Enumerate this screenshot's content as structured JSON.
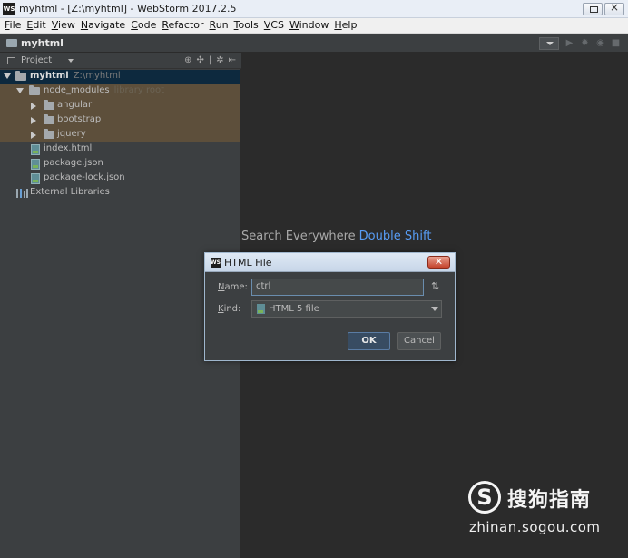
{
  "window": {
    "logo": "WS",
    "title": "myhtml - [Z:\\myhtml] - WebStorm 2017.2.5"
  },
  "menu": [
    {
      "first": "F",
      "rest": "ile"
    },
    {
      "first": "E",
      "rest": "dit"
    },
    {
      "first": "V",
      "rest": "iew"
    },
    {
      "first": "N",
      "rest": "avigate"
    },
    {
      "first": "C",
      "rest": "ode"
    },
    {
      "first": "R",
      "rest": "efactor"
    },
    {
      "first": "R",
      "rest": "un"
    },
    {
      "first": "T",
      "rest": "ools"
    },
    {
      "first": "V",
      "rest": "CS"
    },
    {
      "first": "W",
      "rest": "indow"
    },
    {
      "first": "H",
      "rest": "elp"
    }
  ],
  "navbar": {
    "project_name": "myhtml"
  },
  "project_panel": {
    "header_label": "Project",
    "tree": {
      "root": {
        "label": "myhtml",
        "path": "Z:\\myhtml"
      },
      "node_modules": {
        "label": "node_modules",
        "note": "library root"
      },
      "angular": "angular",
      "bootstrap": "bootstrap",
      "jquery": "jquery",
      "index_html": "index.html",
      "package_json": "package.json",
      "package_lock_json": "package-lock.json",
      "external_libraries": "External Libraries"
    }
  },
  "editor": {
    "hint_text": "Search Everywhere",
    "hint_shortcut": "Double Shift"
  },
  "dialog": {
    "logo": "WS",
    "title": "HTML File",
    "name_label_mn": "N",
    "name_label_rest": "ame:",
    "name_value": "ctrl",
    "kind_label_mn": "K",
    "kind_label_rest": "ind:",
    "kind_value": "HTML 5 file",
    "ok_label": "OK",
    "cancel_label": "Cancel"
  },
  "watermark": {
    "logo": "S",
    "cn_text": "搜狗指南",
    "en_text": "zhinan.sogou.com"
  }
}
